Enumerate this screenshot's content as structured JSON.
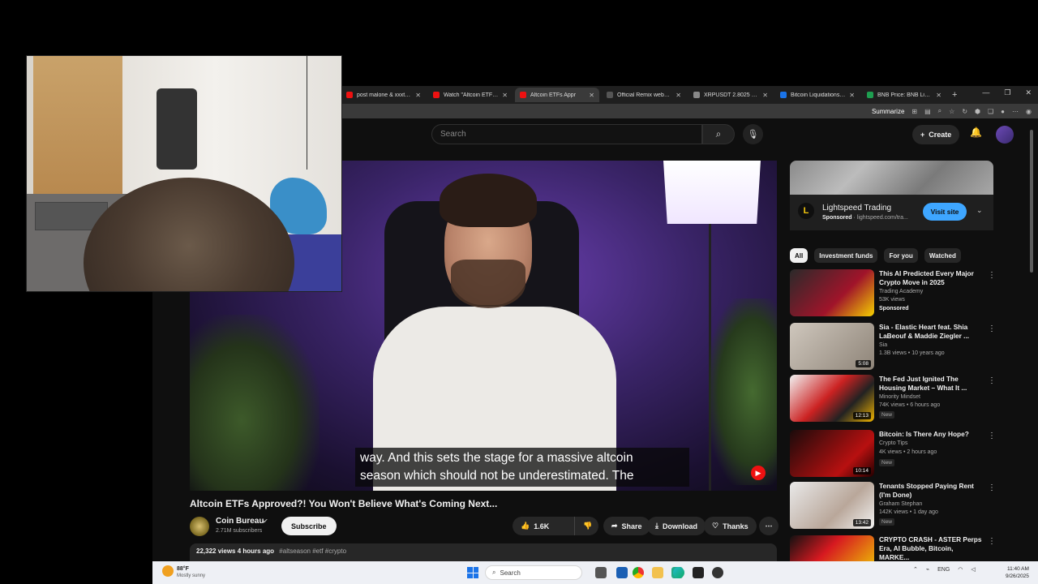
{
  "browser": {
    "tabs": [
      {
        "label": "post malone & xxxtentac",
        "fav": "#e11"
      },
      {
        "label": "Watch \"Altcoin ETFs Ap",
        "fav": "#e11"
      },
      {
        "label": "Altcoin ETFs Appr",
        "fav": "#e11",
        "active": true
      },
      {
        "label": "Official Remix websites",
        "fav": "#555"
      },
      {
        "label": "XRPUSDT 2.8025 ▲ +2",
        "fav": "#888"
      },
      {
        "label": "Bitcoin Liquidations, Cr",
        "fav": "#1a73e8"
      },
      {
        "label": "BNB Price: BNB Live Pr",
        "fav": "#1e9e50"
      }
    ],
    "new_tab": "+",
    "window_controls": [
      "—",
      "❐",
      "✕"
    ],
    "toolbar": {
      "summarize": "Summarize"
    }
  },
  "youtube": {
    "search_placeholder": "Search",
    "create_label": "Create",
    "video": {
      "captions": [
        "way. And this sets the stage for a massive altcoin",
        "season which should not be underestimated. The"
      ],
      "title": "Altcoin ETFs Approved?! You Won't Believe What's Coming Next...",
      "channel": "Coin Bureau",
      "subscribers": "2.71M subscribers",
      "subscribe_label": "Subscribe",
      "likes": "1.6K",
      "share_label": "Share",
      "download_label": "Download",
      "thanks_label": "Thanks",
      "views": "22,322 views",
      "age": "4 hours ago",
      "tags": "#altseason #etf #crypto"
    },
    "ad": {
      "title": "Lightspeed Trading",
      "sponsored": "Sponsored",
      "url": "lightspeed.com/tra...",
      "button": "Visit site",
      "logo": "L"
    },
    "chips": [
      "All",
      "Investment funds",
      "For you",
      "Watched"
    ],
    "recommendations": [
      {
        "title": "This AI Predicted Every Major Crypto Move in 2025",
        "channel": "Trading Academy",
        "meta": "53K views",
        "badge": "",
        "sponsored": "Sponsored",
        "duration": "",
        "thumb": "linear-gradient(135deg,#2a2a2a,#a0142a 60%,#f5d000)"
      },
      {
        "title": "Sia - Elastic Heart feat. Shia LaBeouf & Maddie Ziegler ...",
        "channel": "Sia",
        "meta": "1.3B views • 10 years ago",
        "badge": "",
        "sponsored": "",
        "duration": "5:08",
        "thumb": "linear-gradient(135deg,#cfc7bd,#8e8478)"
      },
      {
        "title": "The Fed Just Ignited The Housing Market – What It ...",
        "channel": "Minority Mindset",
        "meta": "74K views • 6 hours ago",
        "badge": "New",
        "sponsored": "",
        "duration": "12:13",
        "thumb": "linear-gradient(135deg,#f2f2f2,#c22 45%,#222 70%,#f0b400)"
      },
      {
        "title": "Bitcoin: Is There Any Hope?",
        "channel": "Crypto Tips",
        "meta": "4K views • 2 hours ago",
        "badge": "New",
        "sponsored": "",
        "duration": "10:14",
        "thumb": "linear-gradient(135deg,#1a0b0b,#b81010 70%,#200)"
      },
      {
        "title": "Tenants Stopped Paying Rent (I'm Done)",
        "channel": "Graham Stephan",
        "meta": "142K views • 1 day ago",
        "badge": "New",
        "sponsored": "",
        "duration": "13:42",
        "thumb": "linear-gradient(135deg,#e9e9e9,#b9a79a 60%,#f3f3f3)"
      },
      {
        "title": "CRYPTO CRASH - ASTER Perps Era, AI Bubble, Bitcoin, MARKE...",
        "channel": "",
        "meta": "",
        "badge": "",
        "sponsored": "",
        "duration": "",
        "thumb": "linear-gradient(135deg,#111,#d71920 40%,#f0e000)"
      }
    ]
  },
  "taskbar": {
    "temp": "88°F",
    "weather": "Mostly sunny",
    "search": "Search",
    "tray": [
      "⌃",
      "ENG"
    ],
    "time": "11:40 AM",
    "date": "9/26/2025"
  },
  "colors": {
    "accent": "#3ea6ff",
    "yt_bg": "#0f0f0f"
  }
}
